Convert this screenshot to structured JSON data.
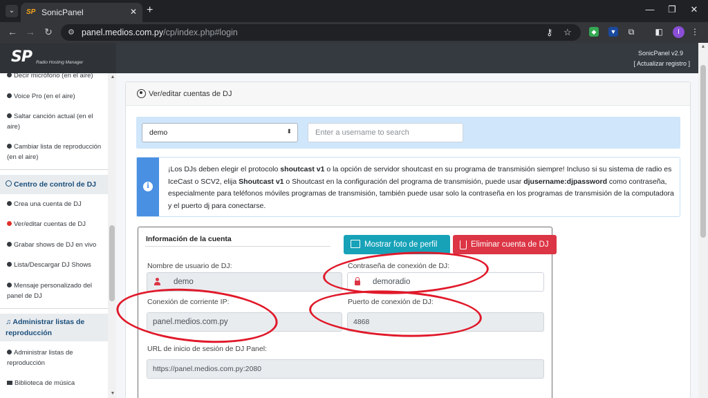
{
  "browser": {
    "tab_title": "SonicPanel",
    "tab_icon": "SP",
    "url_host": "panel.medios.com.py",
    "url_path": "/cp/index.php#login",
    "profile_initial": "I"
  },
  "header": {
    "logo": "SP",
    "logo_subtitle": "Radio Hosting Manager",
    "version": "SonicPanel v2.9",
    "update_link": "[ Actualizar registro ]"
  },
  "sidebar": {
    "items": [
      {
        "label": "Decir micrófono (en el aire)"
      },
      {
        "label": "Voice Pro (en el aire)"
      },
      {
        "label": "Saltar canción actual (en el aire)"
      },
      {
        "label": "Cambiar lista de reproducción (en el aire)"
      },
      {
        "label": "Crea una cuenta de DJ"
      },
      {
        "label": "Ver/editar cuentas de DJ"
      },
      {
        "label": "Grabar shows de DJ en vivo"
      },
      {
        "label": "Lista/Descargar DJ Shows"
      },
      {
        "label": "Mensaje personalizado del panel de DJ"
      },
      {
        "label": "Administrar listas de reproducción"
      },
      {
        "label": "Biblioteca de música"
      }
    ],
    "sections": [
      {
        "label": "Centro de control de DJ"
      },
      {
        "label": "Administrar listas de reproducción"
      }
    ]
  },
  "main": {
    "title": "Ver/editar cuentas de DJ",
    "dj_select_value": "demo",
    "search_placeholder": "Enter a username to search",
    "info": {
      "t1": "¡Los DJs deben elegir el protocolo ",
      "b1": "shoutcast v1",
      "t2": " o la opción de servidor shoutcast en su programa de transmisión siempre! Incluso si su sistema de radio es IceCast o SCV2, elija ",
      "b2": "Shoutcast v1",
      "t3": " o Shoutcast en la configuración del programa de transmisión, puede usar ",
      "b3": "djusername:djpassword",
      "t4": " como contraseña, especialmente para teléfonos móviles programas de transmisión, también puede usar solo la contraseña en los programas de transmisión de la computadora y el puerto dj para conectarse."
    },
    "account": {
      "title": "Información de la cuenta",
      "photo_button": "Mostrar foto de perfil",
      "delete_button": "Eliminar cuenta de DJ",
      "username_label": "Nombre de usuario de DJ:",
      "username_value": "demo",
      "password_label": "Contraseña de conexión de DJ:",
      "password_value": "demoradio",
      "ip_label": "Conexión de corriente IP:",
      "ip_value": "panel.medios.com.py",
      "port_label": "Puerto de conexión de DJ:",
      "port_value": "4868",
      "url_label": "URL de inicio de sesión de DJ Panel:",
      "url_value": "https://panel.medios.com.py:2080"
    }
  },
  "colors": {
    "accent": "#17a2b8",
    "danger": "#dc3545",
    "info_stripe": "#4a90e2",
    "header_bg": "#343a40",
    "annotation": "#e0192a"
  }
}
